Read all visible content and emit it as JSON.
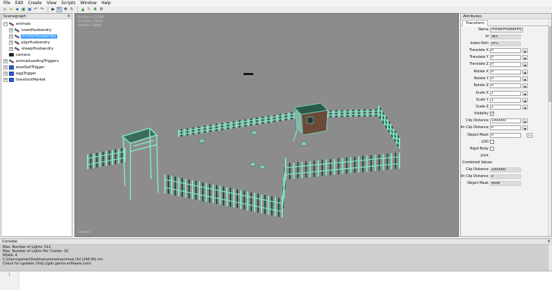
{
  "menu": [
    "File",
    "Edit",
    "Create",
    "View",
    "Scripts",
    "Window",
    "Help"
  ],
  "toolbar": {
    "icons": [
      "new-file-icon",
      "open-folder-icon",
      "save-icon",
      "import-icon",
      "export-icon",
      "undo-icon",
      "redo-icon",
      "play-icon",
      "select-icon",
      "move-icon",
      "rotate-icon",
      "scale-icon",
      "terrain-icon",
      "paint-icon",
      "foliage-icon",
      "settings-icon"
    ]
  },
  "scenegraph": {
    "title": "Scenegraph",
    "close": "×",
    "nodes": [
      {
        "label": "animals",
        "indent": 0,
        "icon": "transform",
        "expander": "−"
      },
      {
        "label": "cowsHusbandry",
        "indent": 1,
        "icon": "transform",
        "expander": "+"
      },
      {
        "label": "chickenHusbandry",
        "indent": 1,
        "icon": "transform",
        "expander": "+",
        "selected": true
      },
      {
        "label": "pigsHusbandry",
        "indent": 1,
        "icon": "transform",
        "expander": "+"
      },
      {
        "label": "sheepHusbandry",
        "indent": 1,
        "icon": "transform",
        "expander": "+"
      },
      {
        "label": "camera",
        "indent": 0,
        "icon": "camera",
        "expander": ""
      },
      {
        "label": "animalLoadingTriggers",
        "indent": 0,
        "icon": "transform",
        "expander": "+"
      },
      {
        "label": "woolSellTrigger",
        "indent": 0,
        "icon": "trigger",
        "expander": "+"
      },
      {
        "label": "eggTrigger",
        "indent": 0,
        "icon": "trigger",
        "expander": "+"
      },
      {
        "label": "livestockMarket",
        "indent": 0,
        "icon": "trigger",
        "expander": "+"
      }
    ]
  },
  "viewport": {
    "stats": [
      "Distance 233.98",
      "Triangles 15926",
      "Vertices 18884"
    ],
    "camera_label": "camera",
    "colors": {
      "background": "#8c8c8c",
      "wire": "#7fe8c8",
      "wire_dark": "#1f4a3e",
      "coop": "#6b4a3a"
    }
  },
  "attributes": {
    "title": "Attributes",
    "tab": "Transform",
    "fields": {
      "name": {
        "label": "Name",
        "value": "chickenHusbandry"
      },
      "id": {
        "label": "Id",
        "value": "383"
      },
      "index_path": {
        "label": "Index Path",
        "value": "0>1"
      },
      "translate_x": {
        "label": "Translate X",
        "value": "0"
      },
      "translate_y": {
        "label": "Translate Y",
        "value": "0"
      },
      "translate_z": {
        "label": "Translate Z",
        "value": "0"
      },
      "rotate_x": {
        "label": "Rotate X",
        "value": "0"
      },
      "rotate_y": {
        "label": "Rotate Y",
        "value": "0"
      },
      "rotate_z": {
        "label": "Rotate Z",
        "value": "0"
      },
      "scale_x": {
        "label": "Scale X",
        "value": "1"
      },
      "scale_y": {
        "label": "Scale Y",
        "value": "1"
      },
      "scale_z": {
        "label": "Scale Z",
        "value": "1"
      },
      "visibility": {
        "label": "Visibility",
        "checked": "✓"
      },
      "clip_distance": {
        "label": "Clip Distance",
        "value": "1000000"
      },
      "min_clip_distance": {
        "label": "Min Clip Distance",
        "value": "0"
      },
      "object_mask": {
        "label": "Object Mask",
        "value": "0"
      },
      "lod": {
        "label": "LOD",
        "checked": ""
      },
      "rigid_body": {
        "label": "Rigid Body",
        "checked": ""
      },
      "joint": {
        "label": "Joint"
      },
      "combined_values": {
        "label": "Combined Values"
      },
      "c_clip_distance": {
        "label": "Clip Distance",
        "value": "1000000"
      },
      "c_min_clip_distance": {
        "label": "Min Clip Distance",
        "value": "0"
      },
      "c_object_mask": {
        "label": "Object Mask",
        "value": "ff00ff"
      }
    },
    "arrows": "◂▸",
    "browse": "..."
  },
  "console": {
    "title": "Console",
    "close": "×",
    "lines": [
      "Max. Number of Lights: 512",
      "Max. Number of Lights Per Cluster: 32",
      "MSAA: 4",
      "C:\\Users\\gamer\\Desktop\\animals\\animals.i3d (248.49) ms",
      "Check for updates (http://gdn.giants-software.com)"
    ]
  },
  "editor": {
    "line_number": "1"
  }
}
